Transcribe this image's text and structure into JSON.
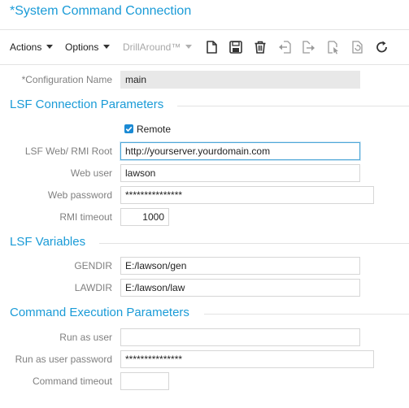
{
  "page": {
    "title": "*System Command Connection"
  },
  "toolbar": {
    "menus": [
      {
        "label": "Actions",
        "enabled": true
      },
      {
        "label": "Options",
        "enabled": true
      },
      {
        "label": "DrillAround™",
        "enabled": false
      }
    ],
    "icons": [
      "new-document-icon",
      "save-icon",
      "delete-icon",
      "previous-record-icon",
      "next-record-icon",
      "open-icon",
      "refresh-form-icon",
      "reload-icon"
    ]
  },
  "config": {
    "label": "*Configuration Name",
    "value": "main"
  },
  "sections": {
    "lsf_connection": "LSF Connection Parameters",
    "lsf_variables": "LSF Variables",
    "command_execution": "Command Execution Parameters"
  },
  "connection": {
    "remote": {
      "label": "Remote",
      "checked": true
    },
    "web_root": {
      "label": "LSF Web/ RMI Root",
      "value": "http://yourserver.yourdomain.com"
    },
    "web_user": {
      "label": "Web user",
      "value": "lawson"
    },
    "web_password": {
      "label": "Web password",
      "value": "***************"
    },
    "rmi_timeout": {
      "label": "RMI timeout",
      "value": "1000"
    }
  },
  "variables": {
    "gendir": {
      "label": "GENDIR",
      "value": "E:/lawson/gen"
    },
    "lawdir": {
      "label": "LAWDIR",
      "value": "E:/lawson/law"
    }
  },
  "execution": {
    "run_as_user": {
      "label": "Run as user",
      "value": ""
    },
    "run_as_password": {
      "label": "Run as user password",
      "value": "***************"
    },
    "command_timeout": {
      "label": "Command timeout",
      "value": ""
    }
  },
  "colors": {
    "accent": "#1a9bd7",
    "label": "#808080",
    "border": "#d6d6d6",
    "checkbox": "#1a8ad4"
  }
}
